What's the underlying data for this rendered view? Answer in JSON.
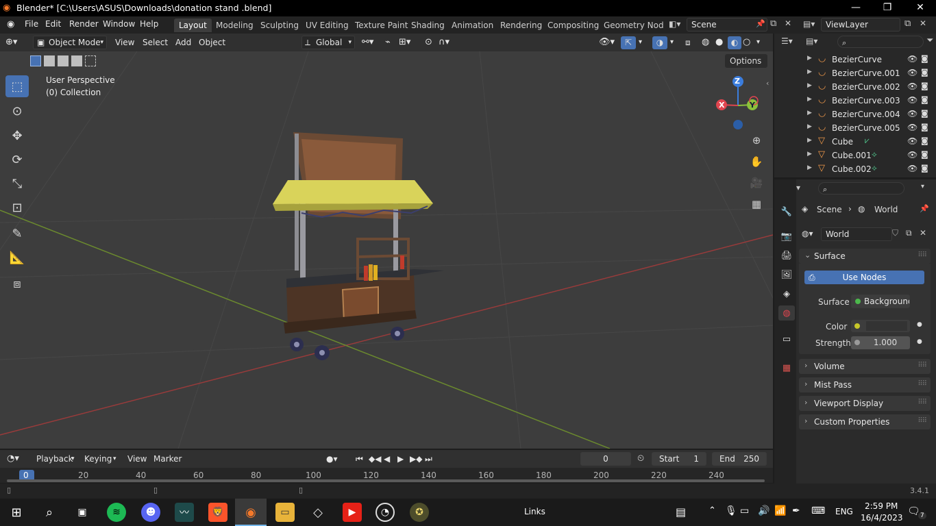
{
  "window": {
    "title": "Blender* [C:\\Users\\ASUS\\Downloads\\donation stand .blend]",
    "controls": {
      "minimize": "—",
      "maximize": "❐",
      "close": "✕"
    }
  },
  "menubar": {
    "items": [
      "File",
      "Edit",
      "Render",
      "Window",
      "Help"
    ],
    "workspaces": [
      "Layout",
      "Modeling",
      "Sculpting",
      "UV Editing",
      "Texture Paint",
      "Shading",
      "Animation",
      "Rendering",
      "Compositing",
      "Geometry Node"
    ],
    "active_workspace": "Layout",
    "scene": "Scene",
    "view_layer": "ViewLayer"
  },
  "viewport_header": {
    "mode": "Object Mode",
    "menus": [
      "View",
      "Select",
      "Add",
      "Object"
    ],
    "orientation": "Global",
    "options_label": "Options"
  },
  "viewport": {
    "view_name": "User Perspective",
    "collection": "(0) Collection",
    "axes": {
      "x": "X",
      "y": "Y",
      "z": "Z"
    }
  },
  "outliner": {
    "rows": [
      {
        "name": "BezierCurve",
        "type": "curve"
      },
      {
        "name": "BezierCurve.001",
        "type": "curve"
      },
      {
        "name": "BezierCurve.002",
        "type": "curve"
      },
      {
        "name": "BezierCurve.003",
        "type": "curve"
      },
      {
        "name": "BezierCurve.004",
        "type": "curve"
      },
      {
        "name": "BezierCurve.005",
        "type": "curve"
      },
      {
        "name": "Cube",
        "type": "mesh"
      },
      {
        "name": "Cube.001",
        "type": "mesh"
      },
      {
        "name": "Cube.002",
        "type": "mesh"
      }
    ]
  },
  "properties": {
    "breadcrumb": {
      "scene": "Scene",
      "world": "World"
    },
    "world_name": "World",
    "surface_panel": "Surface",
    "use_nodes": "Use Nodes",
    "surface_label": "Surface",
    "surface_value": "Background",
    "color_label": "Color",
    "strength_label": "Strength",
    "strength_value": "1.000",
    "collapsed_panels": [
      "Volume",
      "Mist Pass",
      "Viewport Display",
      "Custom Properties"
    ]
  },
  "timeline": {
    "menus": [
      "Playback",
      "Keying",
      "View",
      "Marker"
    ],
    "current_frame": "0",
    "start_label": "Start",
    "start_value": "1",
    "end_label": "End",
    "end_value": "250",
    "ruler_ticks": [
      "0",
      "20",
      "40",
      "60",
      "80",
      "100",
      "120",
      "140",
      "160",
      "180",
      "200",
      "220",
      "240"
    ]
  },
  "statusbar": {
    "version": "3.4.1"
  },
  "taskbar": {
    "links_label": "Links",
    "language": "ENG",
    "time": "2:59 PM",
    "date": "16/4/2023",
    "notifications": "7"
  },
  "colors": {
    "accent": "#4772b3",
    "viewport_bg": "#3d3d3d",
    "axis_x": "#e0454f",
    "axis_y": "#8bc23b",
    "axis_z": "#3b7ddd",
    "awning": "#d9d35a"
  }
}
